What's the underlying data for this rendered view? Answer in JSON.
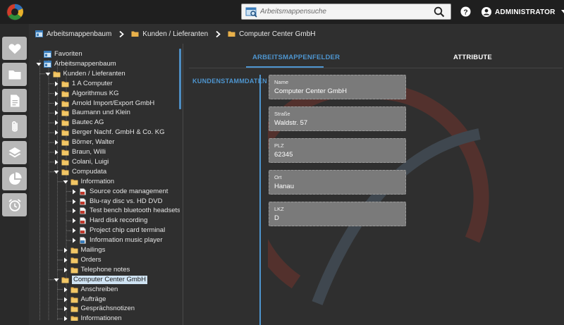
{
  "header": {
    "search_placeholder": "Arbeitsmappensuche",
    "user_name": "ADMINISTRATOR"
  },
  "rail": {
    "items": [
      "favorites-heart-icon",
      "folder-icon",
      "document-icon",
      "attachment-icon",
      "layers-icon",
      "pie-chart-icon",
      "alarm-clock-icon"
    ]
  },
  "breadcrumb": [
    {
      "label": "Arbeitsmappenbaum"
    },
    {
      "label": "Kunden / Lieferanten"
    },
    {
      "label": "Computer Center GmbH"
    }
  ],
  "tree": [
    {
      "label": "Favoriten",
      "icon": "workspace",
      "depth": 0,
      "toggle": "none"
    },
    {
      "label": "Arbeitsmappenbaum",
      "icon": "workspace",
      "depth": 0,
      "toggle": "open"
    },
    {
      "label": "Kunden / Lieferanten",
      "icon": "folder",
      "depth": 1,
      "toggle": "open"
    },
    {
      "label": "1 A Computer",
      "icon": "folder",
      "depth": 2,
      "toggle": "closed"
    },
    {
      "label": "Algorithmus KG",
      "icon": "folder",
      "depth": 2,
      "toggle": "closed"
    },
    {
      "label": "Arnold Import/Export GmbH",
      "icon": "folder",
      "depth": 2,
      "toggle": "closed"
    },
    {
      "label": "Baumann und Klein",
      "icon": "folder",
      "depth": 2,
      "toggle": "closed"
    },
    {
      "label": "Bautec AG",
      "icon": "folder",
      "depth": 2,
      "toggle": "closed"
    },
    {
      "label": "Berger Nachf. GmbH & Co. KG",
      "icon": "folder",
      "depth": 2,
      "toggle": "closed"
    },
    {
      "label": "Börner, Walter",
      "icon": "folder",
      "depth": 2,
      "toggle": "closed"
    },
    {
      "label": "Braun, Willi",
      "icon": "folder",
      "depth": 2,
      "toggle": "closed"
    },
    {
      "label": "Colani, Luigi",
      "icon": "folder",
      "depth": 2,
      "toggle": "closed"
    },
    {
      "label": "Compudata",
      "icon": "folder",
      "depth": 2,
      "toggle": "open"
    },
    {
      "label": "Information",
      "icon": "folder",
      "depth": 3,
      "toggle": "open"
    },
    {
      "label": "Source code management",
      "icon": "doc-red",
      "depth": 4,
      "toggle": "closed"
    },
    {
      "label": "Blu-ray disc vs. HD DVD",
      "icon": "doc-red",
      "depth": 4,
      "toggle": "closed"
    },
    {
      "label": "Test bench bluetooth headsets",
      "icon": "doc-red",
      "depth": 4,
      "toggle": "closed"
    },
    {
      "label": "Hard disk recording",
      "icon": "doc-red",
      "depth": 4,
      "toggle": "closed"
    },
    {
      "label": "Project chip card terminal",
      "icon": "doc-red",
      "depth": 4,
      "toggle": "closed"
    },
    {
      "label": "Information music player",
      "icon": "doc-blue",
      "depth": 4,
      "toggle": "closed"
    },
    {
      "label": "Mailings",
      "icon": "folder",
      "depth": 3,
      "toggle": "closed"
    },
    {
      "label": "Orders",
      "icon": "folder",
      "depth": 3,
      "toggle": "closed"
    },
    {
      "label": "Telephone notes",
      "icon": "folder",
      "depth": 3,
      "toggle": "closed"
    },
    {
      "label": "Computer Center GmbH",
      "icon": "folder",
      "depth": 2,
      "toggle": "open",
      "selected": true
    },
    {
      "label": "Anschreiben",
      "icon": "folder",
      "depth": 3,
      "toggle": "closed"
    },
    {
      "label": "Aufträge",
      "icon": "folder",
      "depth": 3,
      "toggle": "closed"
    },
    {
      "label": "Gesprächsnotizen",
      "icon": "folder",
      "depth": 3,
      "toggle": "closed"
    },
    {
      "label": "Informationen",
      "icon": "folder",
      "depth": 3,
      "toggle": "closed"
    }
  ],
  "tabs": [
    {
      "label": "ARBEITSMAPPENFELDER",
      "active": true
    },
    {
      "label": "ATTRIBUTE",
      "active": false
    }
  ],
  "section": {
    "label": "KUNDENSTAMMDATEN",
    "fields": [
      {
        "label": "Name",
        "value": "Computer Center GmbH"
      },
      {
        "label": "Straße",
        "value": "Waldstr. 57"
      },
      {
        "label": "PLZ",
        "value": "62345"
      },
      {
        "label": "Ort",
        "value": "Hanau"
      },
      {
        "label": "LKZ",
        "value": "D"
      }
    ]
  },
  "colors": {
    "accent": "#4e95cf",
    "folder": "#e8b04a",
    "field_bg": "#7a7a7a",
    "topbar": "#1f1f1f",
    "background": "#2f2f2f"
  }
}
